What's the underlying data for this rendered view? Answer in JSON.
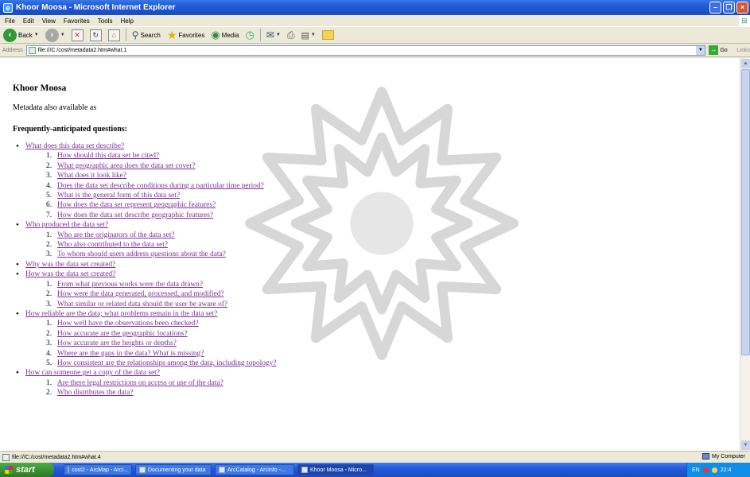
{
  "window": {
    "title": "Khoor Moosa - Microsoft Internet Explorer"
  },
  "menu": [
    "File",
    "Edit",
    "View",
    "Favorites",
    "Tools",
    "Help"
  ],
  "toolbar": {
    "back": "Back",
    "search": "Search",
    "favorites": "Favorites",
    "media": "Media"
  },
  "address": {
    "label": "Address",
    "url": "file:///C:/cost/metadata2.htm#what.1",
    "go": "Go",
    "links": "Links"
  },
  "page": {
    "title": "Khoor Moosa",
    "meta_line": "Metadata also available as",
    "faq_title": "Frequently-anticipated questions:",
    "faq": [
      {
        "q": "What does this data set describe?",
        "sub": [
          "How should this data set be cited?",
          "What geographic area does the data set cover?",
          "What does it look like?",
          "Does the data set describe conditions during a particular time period?",
          "What is the general form of this data set?",
          "How does the data set represent geographic features?",
          "How does the data set describe geographic features?"
        ]
      },
      {
        "q": "Who produced the data set?",
        "sub": [
          "Who are the originators of the data set?",
          "Who also contributed to the data set?",
          "To whom should users address questions about the data?"
        ]
      },
      {
        "q": "Why was the data set created?",
        "sub": []
      },
      {
        "q": "How was the data set created?",
        "sub": [
          "From what previous works were the data drawn?",
          "How were the data generated, processed, and modified?",
          "What similar or related data should the user be aware of?"
        ]
      },
      {
        "q": "How reliable are the data; what problems remain in the data set?",
        "sub": [
          "How well have the observations been checked?",
          "How accurate are the geographic locations?",
          "How accurate are the heights or depths?",
          "Where are the gaps in the data? What is missing?",
          "How consistent are the relationships among the data, including topology?"
        ]
      },
      {
        "q": "How can someone get a copy of the data set?",
        "sub": [
          "Are there legal restrictions on access or use of the data?",
          "Who distributes the data?"
        ]
      }
    ]
  },
  "status": {
    "text": "file:///C:/cost/metadata2.htm#what.4",
    "zone": "My Computer"
  },
  "taskbar": {
    "start": "start",
    "tasks": [
      "cost2 - ArcMap - ArcI...",
      "Documenting your data",
      "ArcCatalog - ArcInfo -...",
      "Khoor Moosa - Micro..."
    ],
    "tray_lang": "EN",
    "clock": "22:4"
  },
  "colors": {
    "link": "#7b2e96",
    "titlebar": "#245edb",
    "start": "#378d2d"
  }
}
